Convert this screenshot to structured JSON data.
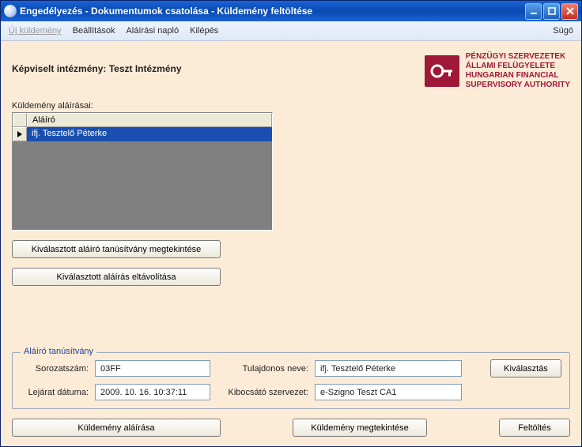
{
  "window_title": "Engedélyezés - Dokumentumok csatolása - Küldemény feltöltése",
  "menu": {
    "new_consignment": "Új küldemény",
    "settings": "Beállítások",
    "signature_log": "Aláírási napló",
    "exit": "Kilépés",
    "help": "Súgó"
  },
  "institution_label": "Képviselt intézmény: Teszt Intézmény",
  "authority_text": "PÉNZÜGYI SZERVEZETEK\nÁLLAMI FELÜGYELETE\nHUNGARIAN FINANCIAL\nSUPERVISORY AUTHORITY",
  "signers_label": "Küldemény aláírásai:",
  "grid": {
    "col_signer": "Aláíró",
    "rows": [
      {
        "signer": "ifj. Tesztelő Péterke"
      }
    ]
  },
  "buttons": {
    "view_cert": "Kiválasztott aláíró tanúsítvány megtekintése",
    "remove_sig": "Kiválasztott aláírás eltávolítása",
    "select": "Kiválasztás",
    "sign": "Küldemény aláírása",
    "view_consignment": "Küldemény megtekintése",
    "upload": "Feltöltés"
  },
  "cert_box": {
    "legend": "Aláíró tanúsítvány",
    "serial_label": "Sorozatszám:",
    "serial": "03FF",
    "expiry_label": "Lejárat dátuma:",
    "expiry": "2009. 10. 16. 10:37:11",
    "owner_label": "Tulajdonos neve:",
    "owner": "ifj. Tesztelő Péterke",
    "issuer_label": "Kibocsátó szervezet:",
    "issuer": "e-Szigno Teszt CA1"
  }
}
